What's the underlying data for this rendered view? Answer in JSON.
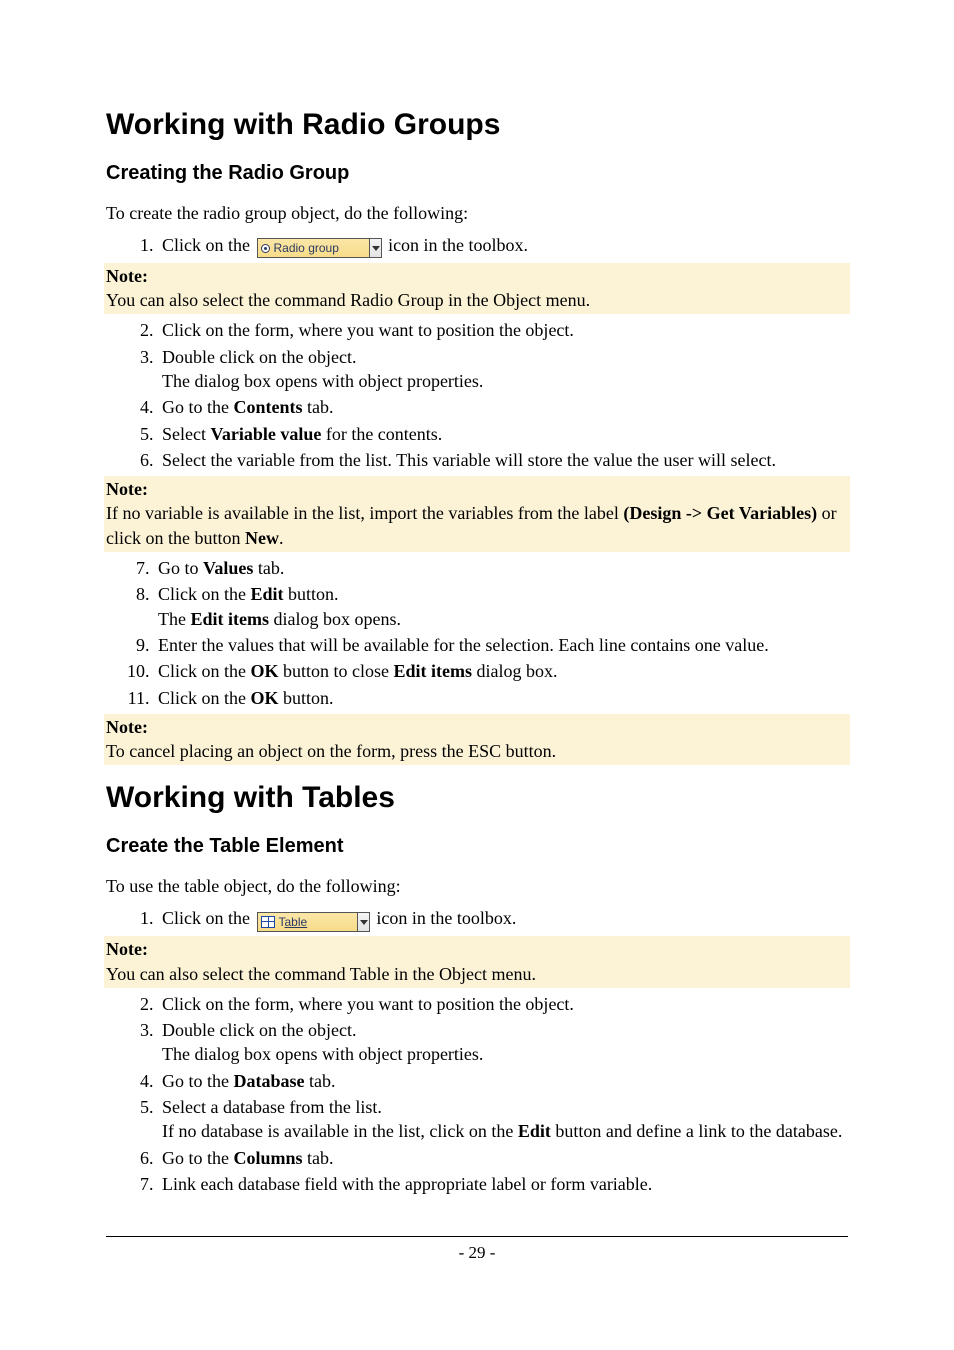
{
  "section1": {
    "h1": "Working with Radio Groups",
    "h2": "Creating the Radio Group",
    "intro": "To create the radio group object, do the following:",
    "step1_pre": "Click on the ",
    "step1_post": " icon in the toolbox.",
    "btn_label": "Radio group",
    "note1_title": "Note:",
    "note1_body": "You can also select the command Radio Group in the Object menu.",
    "step2": "Click on the form, where you want to position the object.",
    "step3": "Double click on the object.",
    "step3b": "The dialog box opens with object properties.",
    "step4_pre": "Go to the ",
    "step4_b": "Contents",
    "step4_post": " tab.",
    "step5_pre": "Select ",
    "step5_b": "Variable value",
    "step5_post": " for the contents.",
    "step6": "Select the variable from the list. This variable will store the value the user will select.",
    "note2_title": "Note:",
    "note2_body_pre": "If no variable is available in the list, import the variables from the label ",
    "note2_b1": "(Design -> Get Variables)",
    "note2_body_mid": " or click on the button ",
    "note2_b2": "New",
    "note2_body_post": ".",
    "step7_pre": "Go to ",
    "step7_b": "Values",
    "step7_post": " tab.",
    "step8_pre": "Click on the ",
    "step8_b": "Edit",
    "step8_post": " button.",
    "step8b_pre": "The ",
    "step8b_b": "Edit items",
    "step8b_post": " dialog box opens.",
    "step9": "Enter the values that will be available for the selection. Each line contains one value.",
    "step10_pre": "Click on the ",
    "step10_b1": "OK",
    "step10_mid": " button to close ",
    "step10_b2": "Edit items",
    "step10_post": " dialog box.",
    "step11_pre": "Click on the ",
    "step11_b": "OK",
    "step11_post": " button.",
    "note3_title": "Note:",
    "note3_body": "To cancel placing an object on the form, press the ESC button."
  },
  "section2": {
    "h1": "Working with Tables",
    "h2": "Create the Table Element",
    "intro": "To use the table object, do the following:",
    "step1_pre": "Click on the ",
    "step1_post": " icon in the toolbox.",
    "btn_prefix": "T",
    "btn_rest": "able",
    "note1_title": "Note:",
    "note1_body": "You can also select the command Table in the Object menu.",
    "step2": "Click on the form, where you want to position the object.",
    "step3": "Double click on the object.",
    "step3b": "The dialog box opens with object properties.",
    "step4_pre": "Go to the ",
    "step4_b": "Database",
    "step4_post": " tab.",
    "step5": "Select a database from the list.",
    "step5b_pre": "If no database is available in the list, click on the ",
    "step5b_b": "Edit",
    "step5b_post": " button and define a link to the database.",
    "step6_pre": "Go to the ",
    "step6_b": "Columns",
    "step6_post": " tab.",
    "step7": "Link each database field with the appropriate label or form variable."
  },
  "footer": {
    "page": "- 29 -"
  }
}
